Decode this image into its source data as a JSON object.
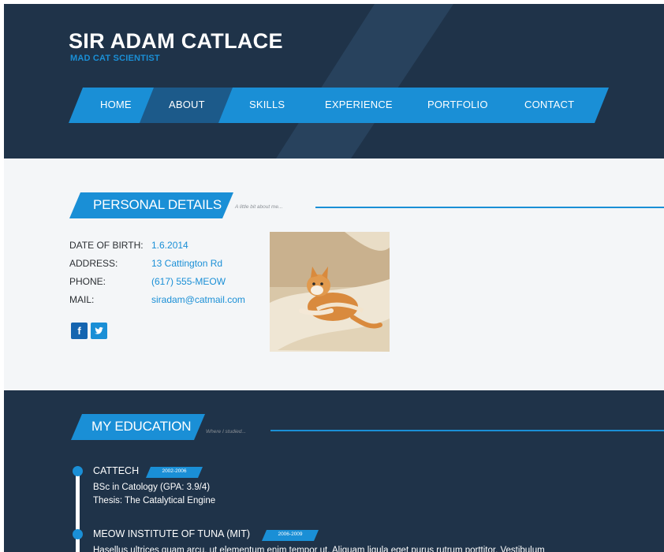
{
  "header": {
    "name": "SIR ADAM CATLACE",
    "tagline": "MAD CAT SCIENTIST"
  },
  "nav": {
    "items": [
      {
        "label": "HOME"
      },
      {
        "label": "ABOUT"
      },
      {
        "label": "SKILLS"
      },
      {
        "label": "EXPERIENCE"
      },
      {
        "label": "PORTFOLIO"
      },
      {
        "label": "CONTACT"
      }
    ]
  },
  "personal": {
    "title": "PERSONAL DETAILS",
    "subtitle": "A little bit about me...",
    "rows": [
      {
        "label": "DATE OF BIRTH:",
        "value": "1.6.2014"
      },
      {
        "label": "ADDRESS:",
        "value": "13 Cattington Rd"
      },
      {
        "label": "PHONE:",
        "value": "(617) 555-MEOW"
      },
      {
        "label": "MAIL:",
        "value": "siradam@catmail.com"
      }
    ],
    "social": {
      "facebook": "f",
      "twitter": "t"
    }
  },
  "education": {
    "title": "MY EDUCATION",
    "subtitle": "Where I studied...",
    "entries": [
      {
        "school": "CATTECH",
        "years": "2002-2006",
        "lines": [
          "BSc in Catology (GPA: 3.9/4)",
          "Thesis: The Catalytical Engine"
        ]
      },
      {
        "school": "MEOW INSTITUTE OF TUNA (MIT)",
        "years": "2006-2009",
        "lines": [
          "Hasellus ultrices quam arcu, ut elementum enim tempor ut. Aliquam ligula eget purus rutrum porttitor. Vestibulum"
        ]
      }
    ]
  },
  "colors": {
    "navy": "#1f3349",
    "accent": "#1a8fd6",
    "light": "#f4f6f8"
  }
}
